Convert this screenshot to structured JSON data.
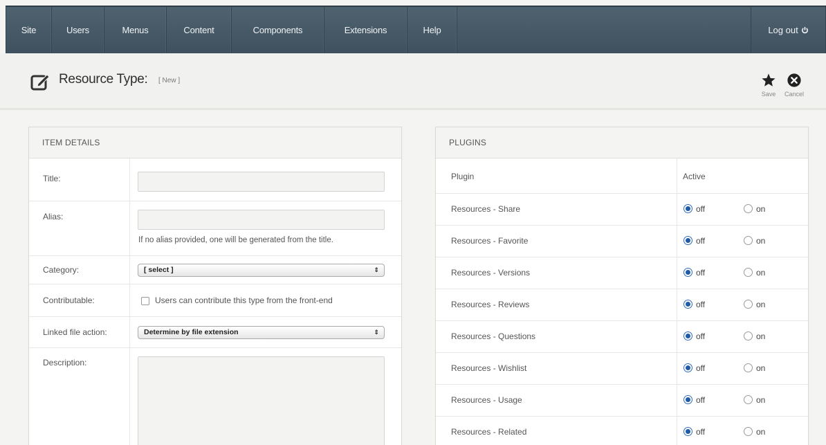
{
  "nav": {
    "items": [
      "Site",
      "Users",
      "Menus",
      "Content",
      "Components",
      "Extensions",
      "Help"
    ],
    "logout": "Log out"
  },
  "header": {
    "title": "Resource Type:",
    "subtitle": "[ New ]",
    "save_label": "Save",
    "cancel_label": "Cancel"
  },
  "details": {
    "heading": "ITEM DETAILS",
    "title_label": "Title:",
    "title_value": "",
    "alias_label": "Alias:",
    "alias_value": "",
    "alias_hint": "If no alias provided, one will be generated from the title.",
    "category_label": "Category:",
    "category_value": "[ select ]",
    "contributable_label": "Contributable:",
    "contributable_text": "Users can contribute this type from the front-end",
    "linked_label": "Linked file action:",
    "linked_value": "Determine by file extension",
    "description_label": "Description:"
  },
  "plugins": {
    "heading": "PLUGINS",
    "col_plugin": "Plugin",
    "col_active": "Active",
    "off_label": "off",
    "on_label": "on",
    "rows": [
      {
        "name": "Resources - Share",
        "active": "off"
      },
      {
        "name": "Resources - Favorite",
        "active": "off"
      },
      {
        "name": "Resources - Versions",
        "active": "off"
      },
      {
        "name": "Resources - Reviews",
        "active": "off"
      },
      {
        "name": "Resources - Questions",
        "active": "off"
      },
      {
        "name": "Resources - Wishlist",
        "active": "off"
      },
      {
        "name": "Resources - Usage",
        "active": "off"
      },
      {
        "name": "Resources - Related",
        "active": "off"
      }
    ]
  },
  "icons": {
    "edit": "edit-icon",
    "save": "star-icon",
    "cancel": "cancel-circle-icon",
    "logout": "power-icon"
  },
  "colors": {
    "nav_bg": "#46596a",
    "radio_accent": "#1e5aa6"
  }
}
